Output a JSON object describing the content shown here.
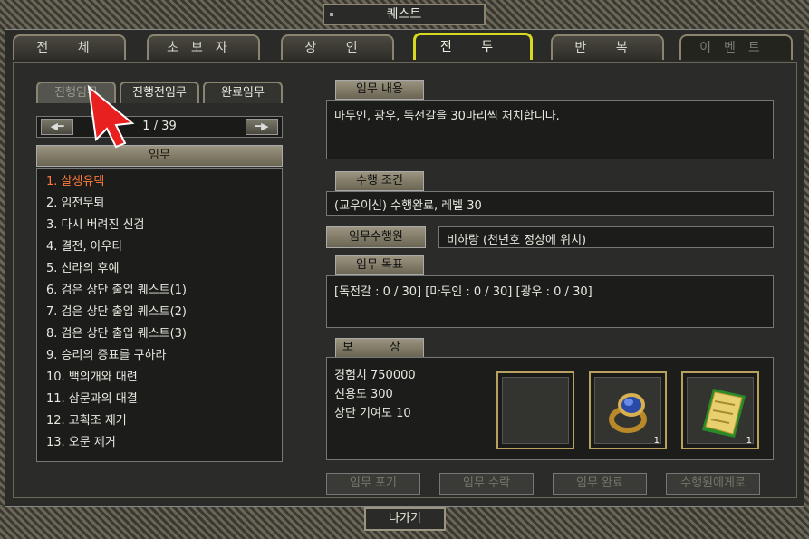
{
  "window": {
    "title": "퀘스트"
  },
  "tabs": [
    {
      "label": "전 체",
      "state": "normal"
    },
    {
      "label": "초보자",
      "state": "normal"
    },
    {
      "label": "상 인",
      "state": "normal"
    },
    {
      "label": "전 투",
      "state": "active"
    },
    {
      "label": "반 복",
      "state": "normal"
    },
    {
      "label": "이벤트",
      "state": "disabled"
    }
  ],
  "subtabs": [
    {
      "label": "진행임무",
      "state": "dim"
    },
    {
      "label": "진행전임무",
      "state": "active"
    },
    {
      "label": "완료임무",
      "state": "normal"
    }
  ],
  "pager": {
    "text": "1 / 39",
    "prev_icon": "left-arrow-icon",
    "next_icon": "right-arrow-icon"
  },
  "list": {
    "header": "임무",
    "items": [
      "1. 살생유택",
      "2. 임전무퇴",
      "3. 다시 버려진 신검",
      "4. 결전, 아우타",
      "5. 신라의 후예",
      "6. 검은 상단 출입 퀘스트(1)",
      "7. 검은 상단 출입 퀘스트(2)",
      "8. 검은 상단 출입 퀘스트(3)",
      "9. 승리의 증표를 구하라",
      "10. 백의개와 대련",
      "11. 삼문과의 대결",
      "12. 고획조 제거",
      "13. 오문 제거"
    ],
    "selected_index": 0
  },
  "details": {
    "content_label": "임무 내용",
    "content_text": "마두인, 광우, 독전갈을 30마리씩 처치합니다.",
    "condition_label": "수행 조건",
    "condition_text": "(교우이신) 수행완료, 레벨 30",
    "npc_button": "임무수행원",
    "npc_text": "비하랑 (천년호 정상에 위치)",
    "goal_label": "임무 목표",
    "goal_text": "[독전갈 : 0 / 30] [마두인 : 0 / 30] [광우 : 0 / 30]",
    "reward_label": "보 상",
    "reward_lines": [
      "경험치 750000",
      "신용도 300",
      "상단 기여도 10"
    ],
    "reward_items": [
      {
        "icon": "empty-slot",
        "count": ""
      },
      {
        "icon": "ring-icon",
        "count": "1"
      },
      {
        "icon": "scroll-icon",
        "count": "1"
      }
    ]
  },
  "actions": [
    "임무 포기",
    "임무 수락",
    "임무 완료",
    "수행원에게로"
  ],
  "exit_button": "나가기",
  "colors": {
    "selected_item": "#ff7a3a",
    "active_tab_border": "#d8d820"
  }
}
